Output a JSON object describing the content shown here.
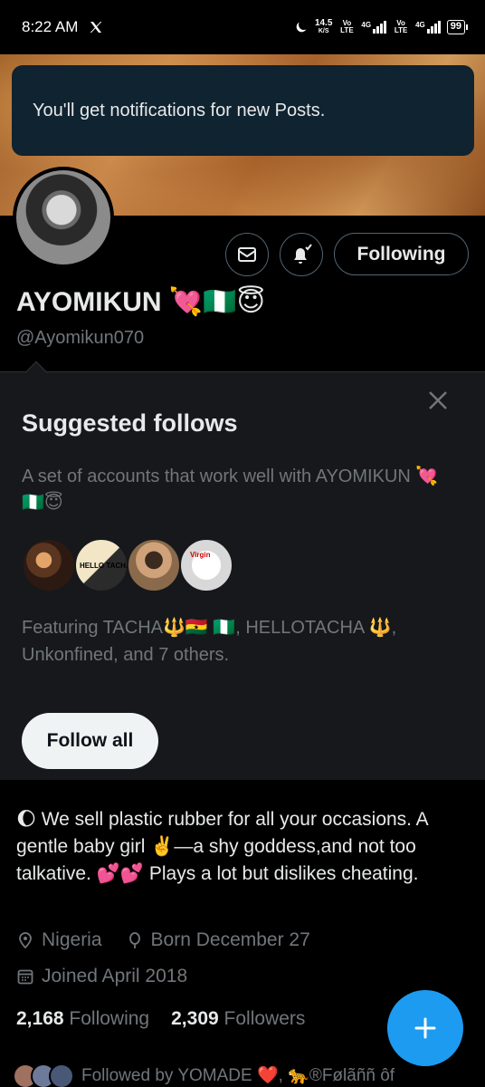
{
  "status_bar": {
    "time": "8:22 AM",
    "net_speed": "14.5",
    "net_unit": "K/S",
    "volte1": "Vo LTE",
    "net1": "4G",
    "volte2": "Vo LTE",
    "net2": "4G",
    "battery": "99"
  },
  "toast": {
    "text": "You'll get notifications for new Posts."
  },
  "profile": {
    "display_name": "AYOMIKUN 💘🇳🇬😇",
    "handle": "@Ayomikun070",
    "following_button": "Following"
  },
  "suggested": {
    "title": "Suggested follows",
    "description": "A set of accounts that work well with AYOMIKUN 💘🇳🇬😇",
    "avatar_label_2": "HELLO TACHA",
    "avatar_label_4": "Virgin",
    "featuring": "Featuring TACHA🔱🇬🇭 🇳🇬, HELLOTACHA 🔱, Unkonfined, and 7 others.",
    "follow_all": "Follow all"
  },
  "bio": {
    "text": "🌔 We sell plastic rubber for all your occasions. A gentle baby girl ✌️—a shy goddess,and not too talkative. 💕💕 Plays a lot but dislikes cheating.",
    "location": "Nigeria",
    "birthday": "Born December 27",
    "joined": "Joined April 2018"
  },
  "counts": {
    "following_count": "2,168",
    "following_label": "Following",
    "followers_count": "2,309",
    "followers_label": "Followers"
  },
  "followed_by": {
    "text": "Followed by YOMADE ❤️, 🐆®Følãññ ôf"
  },
  "colors": {
    "accent": "#1d9bf0",
    "toast_bg": "#0f2330",
    "muted": "#71767b",
    "panel_bg": "#16181c"
  },
  "icons": [
    "x-logo",
    "moon-icon",
    "mail-icon",
    "bell-check-icon",
    "close-icon",
    "location-icon",
    "birthday-icon",
    "calendar-icon",
    "plus-icon"
  ]
}
